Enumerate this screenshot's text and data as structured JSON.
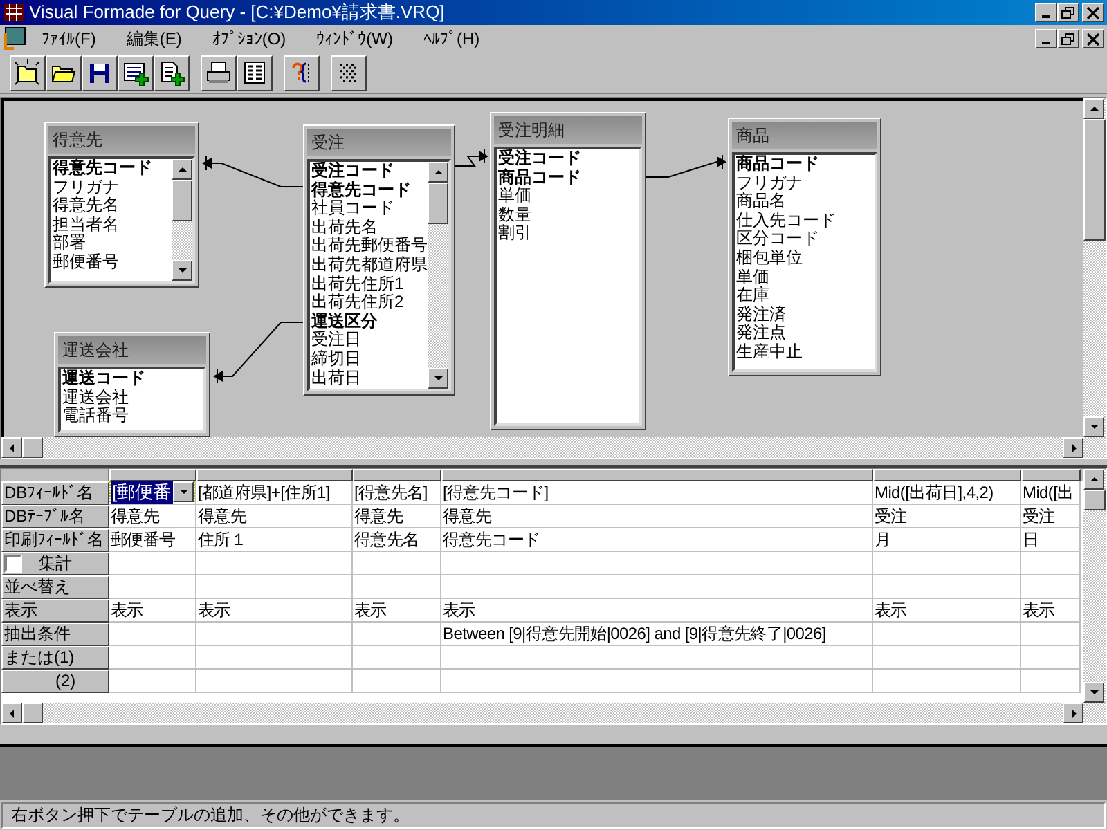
{
  "window": {
    "title": "Visual Formade for Query - [C:¥Demo¥請求書.VRQ]"
  },
  "menu": [
    "ﾌｧｲﾙ(F)",
    "編集(E)",
    "ｵﾌﾟｼｮﾝ(O)",
    "ｳｨﾝﾄﾞｳ(W)",
    "ﾍﾙﾌﾟ(H)"
  ],
  "diagram": {
    "tables": [
      {
        "title": "得意先",
        "scrollbar": true,
        "fields": [
          {
            "name": "得意先コード",
            "key": true
          },
          {
            "name": "フリガナ",
            "key": false
          },
          {
            "name": "得意先名",
            "key": false
          },
          {
            "name": "担当者名",
            "key": false
          },
          {
            "name": "部署",
            "key": false
          },
          {
            "name": "郵便番号",
            "key": false
          }
        ]
      },
      {
        "title": "受注",
        "scrollbar": true,
        "fields": [
          {
            "name": "受注コード",
            "key": true
          },
          {
            "name": "得意先コード",
            "key": true
          },
          {
            "name": "社員コード",
            "key": false
          },
          {
            "name": "出荷先名",
            "key": false
          },
          {
            "name": "出荷先郵便番号",
            "key": false
          },
          {
            "name": "出荷先都道府県",
            "key": false
          },
          {
            "name": "出荷先住所1",
            "key": false
          },
          {
            "name": "出荷先住所2",
            "key": false
          },
          {
            "name": "運送区分",
            "key": true
          },
          {
            "name": "受注日",
            "key": false
          },
          {
            "name": "締切日",
            "key": false
          },
          {
            "name": "出荷日",
            "key": false
          }
        ]
      },
      {
        "title": "受注明細",
        "scrollbar": false,
        "fields": [
          {
            "name": "受注コード",
            "key": true
          },
          {
            "name": "商品コード",
            "key": true
          },
          {
            "name": "単価",
            "key": false
          },
          {
            "name": "数量",
            "key": false
          },
          {
            "name": "割引",
            "key": false
          }
        ]
      },
      {
        "title": "商品",
        "scrollbar": false,
        "fields": [
          {
            "name": "商品コード",
            "key": true
          },
          {
            "name": "フリガナ",
            "key": false
          },
          {
            "name": "商品名",
            "key": false
          },
          {
            "name": "仕入先コード",
            "key": false
          },
          {
            "name": "区分コード",
            "key": false
          },
          {
            "name": "梱包単位",
            "key": false
          },
          {
            "name": "単価",
            "key": false
          },
          {
            "name": "在庫",
            "key": false
          },
          {
            "name": "発注済",
            "key": false
          },
          {
            "name": "発注点",
            "key": false
          },
          {
            "name": "生産中止",
            "key": false
          }
        ]
      },
      {
        "title": "運送会社",
        "scrollbar": false,
        "fields": [
          {
            "name": "運送コード",
            "key": true
          },
          {
            "name": "運送会社",
            "key": false
          },
          {
            "name": "電話番号",
            "key": false
          }
        ]
      }
    ]
  },
  "grid": {
    "rows": [
      {
        "header": "DBﾌｨｰﾙﾄﾞ名",
        "kind": "text",
        "cells": [
          {
            "text": "[郵便番",
            "selected": true
          },
          {
            "text": "[都道府県]+[住所1]",
            "selected": false
          },
          {
            "text": "[得意先名]",
            "selected": false
          },
          {
            "text": "[得意先コード]",
            "selected": false
          },
          {
            "text": "Mid([出荷日],4,2)",
            "selected": false
          },
          {
            "text": "Mid([出",
            "selected": false
          }
        ]
      },
      {
        "header": "DBﾃｰﾌﾞﾙ名",
        "kind": "text",
        "cells": [
          "得意先",
          "得意先",
          "得意先",
          "得意先",
          "受注",
          "受注"
        ]
      },
      {
        "header": "印刷ﾌｨｰﾙﾄﾞ名",
        "kind": "text",
        "cells": [
          "郵便番号",
          "住所１",
          "得意先名",
          "得意先コード",
          "月",
          "日"
        ]
      },
      {
        "header": "集計",
        "kind": "checkbox",
        "checked": false,
        "cells": [
          null,
          null,
          null,
          null,
          null,
          null
        ]
      },
      {
        "header": "並べ替え",
        "kind": "text",
        "cells": [
          null,
          null,
          null,
          null,
          null,
          null
        ]
      },
      {
        "header": "表示",
        "kind": "text",
        "cells": [
          "表示",
          "表示",
          "表示",
          "表示",
          "表示",
          "表示"
        ]
      },
      {
        "header": "抽出条件",
        "kind": "text",
        "cells": [
          null,
          null,
          null,
          "Between [9|得意先開始|0026] and [9|得意先終了|0026]",
          null,
          null
        ]
      },
      {
        "header": "または(1)",
        "kind": "text",
        "cells": [
          null,
          null,
          null,
          null,
          null,
          null
        ]
      },
      {
        "header": "(2)",
        "kind": "indented",
        "cells": [
          null,
          null,
          null,
          null,
          null,
          null
        ]
      }
    ]
  },
  "status_bar": "右ボタン押下でテーブルの追加、その他ができます。"
}
